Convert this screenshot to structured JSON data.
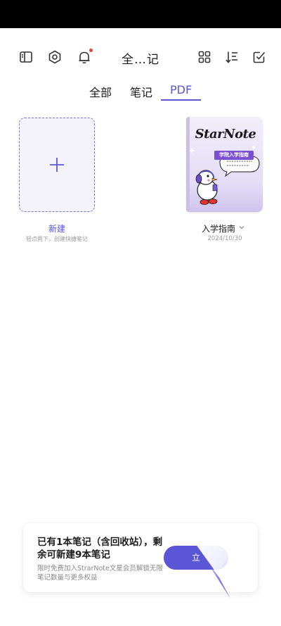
{
  "header": {
    "title": "全…记",
    "icons": [
      "sidebar-icon",
      "settings-hexagon-icon",
      "bell-icon",
      "grid-icon",
      "sort-icon",
      "select-check-icon"
    ],
    "bell_badge_color": "#e0453a"
  },
  "tabs": [
    {
      "label": "全部",
      "active": false
    },
    {
      "label": "笔记",
      "active": false
    },
    {
      "label": "PDF",
      "active": true
    }
  ],
  "accent_color": "#5b56d6",
  "new_note": {
    "label": "新建",
    "hint": "轻点两下，创建快捷笔记"
  },
  "notebooks": [
    {
      "cover_brand": "StarNote",
      "cover_subtitle": "学院入学指南",
      "title": "入学指南",
      "date": "2024/10/30"
    }
  ],
  "promo": {
    "main_text": "已有1本笔记（含回收站），剩余可新建9本笔记",
    "sub_text": "限时免费加入StrarNote文星会员解锁无限笔记数量与更多权益",
    "button_label": "立"
  }
}
